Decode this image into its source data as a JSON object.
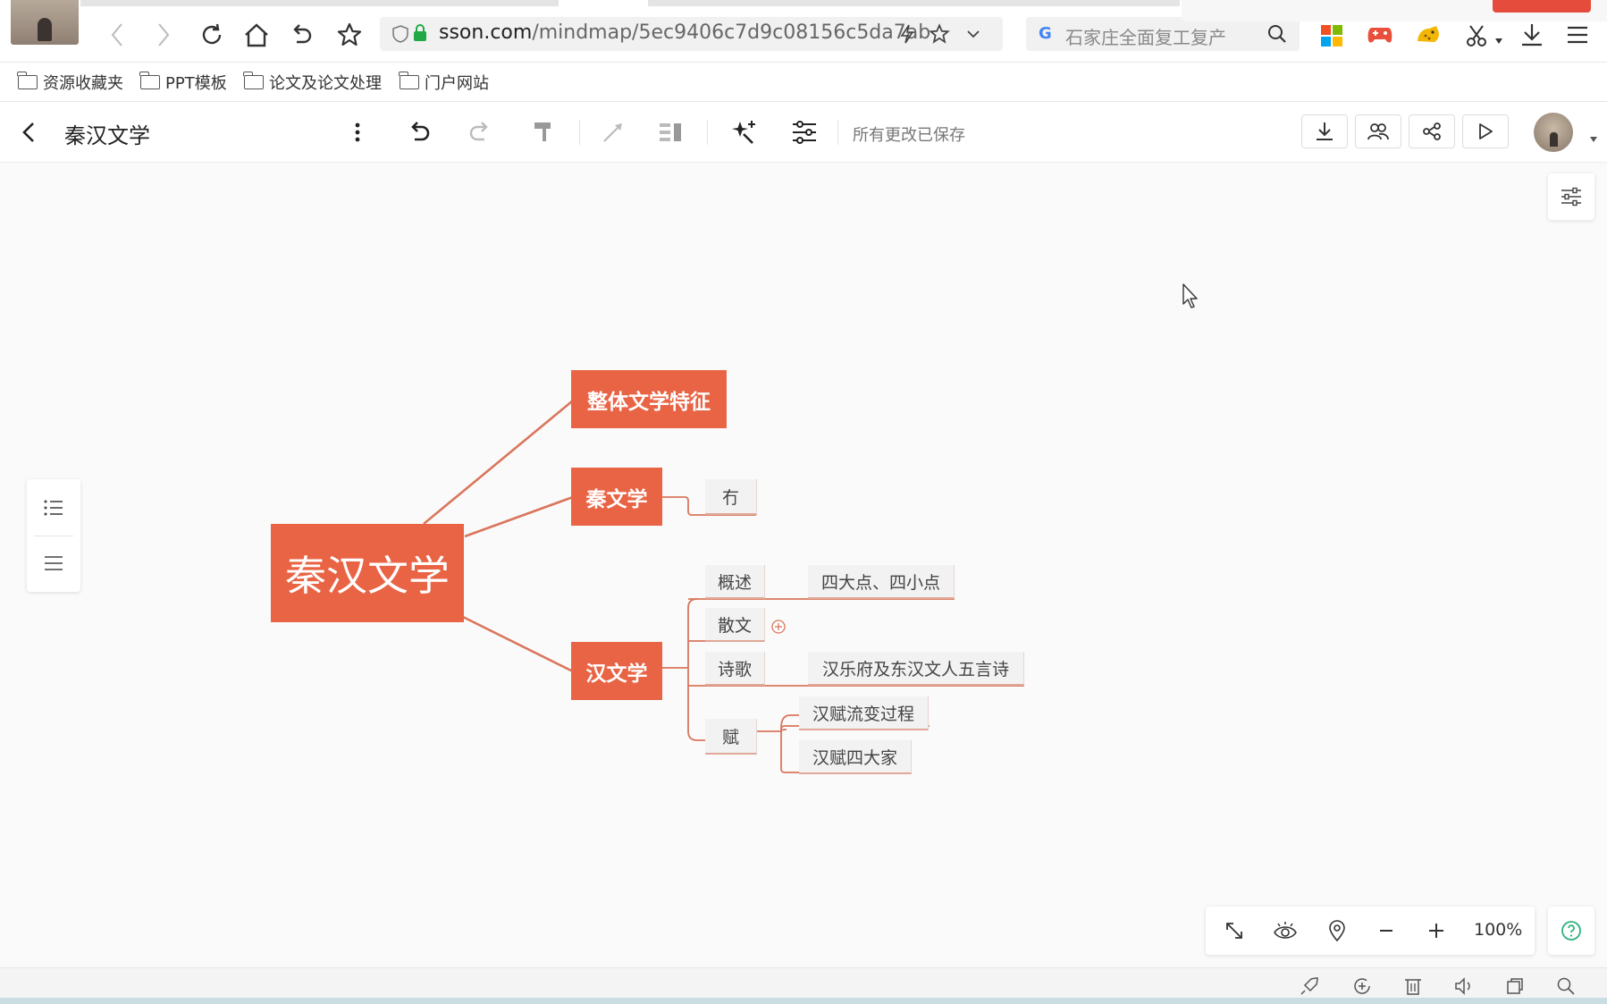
{
  "browser": {
    "url_domain": "sson.com",
    "url_path": "/mindmap/5ec9406c7d9c08156c5da7ab",
    "search_placeholder": "石家庄全面复工复产"
  },
  "bookmarks": [
    {
      "label": "资源收藏夹"
    },
    {
      "label": "PPT模板"
    },
    {
      "label": "论文及论文处理"
    },
    {
      "label": "门户网站"
    }
  ],
  "app": {
    "title": "秦汉文学",
    "save_status": "所有更改已保存"
  },
  "mindmap": {
    "root": "秦汉文学",
    "branches": {
      "overall": "整体文学特征",
      "qin": "秦文学",
      "qin_children": [
        "冇"
      ],
      "han": "汉文学",
      "han_children": {
        "overview": "概述",
        "overview_child": "四大点、四小点",
        "prose": "散文",
        "poetry": "诗歌",
        "poetry_child": "汉乐府及东汉文人五言诗",
        "fu": "赋",
        "fu_children": [
          "汉赋流变过程",
          "汉赋四大家"
        ]
      }
    }
  },
  "zoom": {
    "level": "100%"
  },
  "colors": {
    "node_accent": "#e96445",
    "connector": "#d9765c",
    "sub_border": "#e0a898"
  }
}
